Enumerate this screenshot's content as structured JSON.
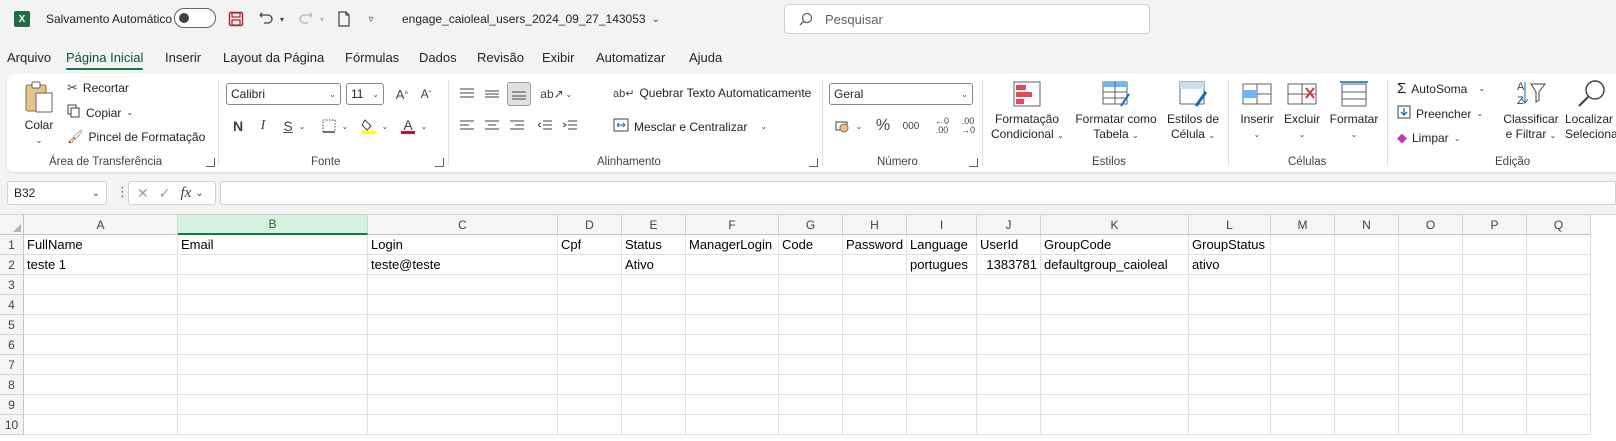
{
  "title_bar": {
    "autosave_label": "Salvamento Automático",
    "filename": "engage_caioleal_users_2024_09_27_143053",
    "search_placeholder": "Pesquisar"
  },
  "menu": {
    "tabs": [
      "Arquivo",
      "Página Inicial",
      "Inserir",
      "Layout da Página",
      "Fórmulas",
      "Dados",
      "Revisão",
      "Exibir",
      "Automatizar",
      "Ajuda"
    ],
    "active": "Página Inicial"
  },
  "ribbon": {
    "clipboard": {
      "paste": "Colar",
      "cut": "Recortar",
      "copy": "Copiar",
      "format_painter": "Pincel de Formatação",
      "label": "Área de Transferência"
    },
    "font": {
      "family": "Calibri",
      "size": "11",
      "bold": "N",
      "italic": "I",
      "underline": "S",
      "label": "Fonte"
    },
    "alignment": {
      "wrap_text": "Quebrar Texto Automaticamente",
      "merge_center": "Mesclar e Centralizar",
      "label": "Alinhamento"
    },
    "number": {
      "format": "Geral",
      "percent": "%",
      "thousands": "000",
      "label": "Número"
    },
    "styles": {
      "conditional_1": "Formatação",
      "conditional_2": "Condicional",
      "table_1": "Formatar como",
      "table_2": "Tabela",
      "cell_styles_1": "Estilos de",
      "cell_styles_2": "Célula",
      "label": "Estilos"
    },
    "cells": {
      "insert": "Inserir",
      "delete": "Excluir",
      "format": "Formatar",
      "label": "Células"
    },
    "editing": {
      "autosum": "AutoSoma",
      "fill": "Preencher",
      "clear": "Limpar",
      "sort_1": "Classificar",
      "sort_2": "e Filtrar",
      "find_1": "Localizar e",
      "find_2": "Selecionar",
      "label": "Edição"
    }
  },
  "formula_bar": {
    "name_box": "B32",
    "fx": "fx",
    "content": ""
  },
  "sheet": {
    "columns": [
      "A",
      "B",
      "C",
      "D",
      "E",
      "F",
      "G",
      "H",
      "I",
      "J",
      "K",
      "L",
      "M",
      "N",
      "O",
      "P",
      "Q"
    ],
    "selected_column": "B",
    "row_numbers": [
      "1",
      "2",
      "3",
      "4",
      "5",
      "6",
      "7",
      "8",
      "9",
      "10"
    ],
    "header_row": [
      "FullName",
      "Email",
      "Login",
      "Cpf",
      "Status",
      "ManagerLogin",
      "Code",
      "Password",
      "Language",
      "UserId",
      "GroupCode",
      "GroupStatus",
      "",
      "",
      "",
      "",
      ""
    ],
    "data_row": [
      "teste 1",
      "",
      "teste@teste",
      "",
      "Ativo",
      "",
      "",
      "",
      "portugues",
      "1383781",
      "defaultgroup_caioleal",
      "ativo",
      "",
      "",
      "",
      "",
      ""
    ]
  },
  "colors": {
    "accent": "#107c41",
    "font_color": "#c50f1f",
    "highlight": "#ffff00"
  }
}
